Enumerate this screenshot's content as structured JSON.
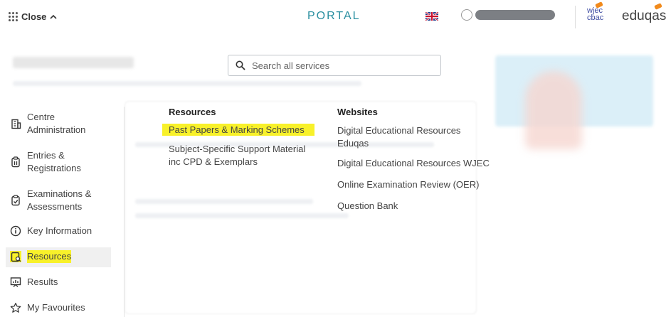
{
  "topbar": {
    "close_label": "Close",
    "portal_title": "PORTAL",
    "logo_wjec_top": "wjec",
    "logo_wjec_bottom": "cbac",
    "logo_eduqas": "eduqas",
    "colors": {
      "portal": "#2a8fa0",
      "wjec": "#3c4aa0",
      "eduqas_accent": "#f18a1c"
    }
  },
  "search": {
    "placeholder": "Search all services"
  },
  "sidebar": {
    "items": [
      {
        "label_line1": "Centre",
        "label_line2": "Administration",
        "icon": "building-icon"
      },
      {
        "label_line1": "Entries &",
        "label_line2": "Registrations",
        "icon": "clipboard-icon"
      },
      {
        "label_line1": "Examinations &",
        "label_line2": "Assessments",
        "icon": "checklist-icon"
      },
      {
        "label": "Key Information",
        "icon": "info-icon"
      },
      {
        "label": "Resources",
        "icon": "resources-icon",
        "active": true
      },
      {
        "label": "Results",
        "icon": "results-chart-icon"
      },
      {
        "label": "My Favourites",
        "icon": "star-icon"
      }
    ]
  },
  "resources_column": {
    "heading": "Resources",
    "links": [
      {
        "label": "Past Papers & Marking Schemes",
        "highlighted": true
      },
      {
        "line1": "Subject-Specific Support Material",
        "line2": "inc CPD & Exemplars"
      }
    ]
  },
  "websites_column": {
    "heading": "Websites",
    "links": [
      {
        "line1": "Digital Educational Resources",
        "line2": "Eduqas"
      },
      {
        "label": "Digital Educational Resources WJEC"
      },
      {
        "label": "Online Examination Review (OER)"
      },
      {
        "label": "Question Bank"
      }
    ]
  },
  "highlight_color": "#f8f12a"
}
